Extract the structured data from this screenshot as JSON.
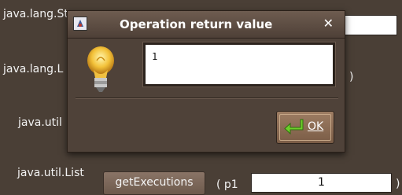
{
  "background": {
    "labels": [
      "java.lang.St",
      "java.lang.L",
      "java.util",
      "java.util.List"
    ],
    "paren_close": ")",
    "method_button": "getExecutions",
    "param_label": "( p1",
    "param_value": "1",
    "param_close": ")"
  },
  "dialog": {
    "title": "Operation return value",
    "close_glyph": "✕",
    "return_value": "1",
    "ok_label": "OK"
  }
}
